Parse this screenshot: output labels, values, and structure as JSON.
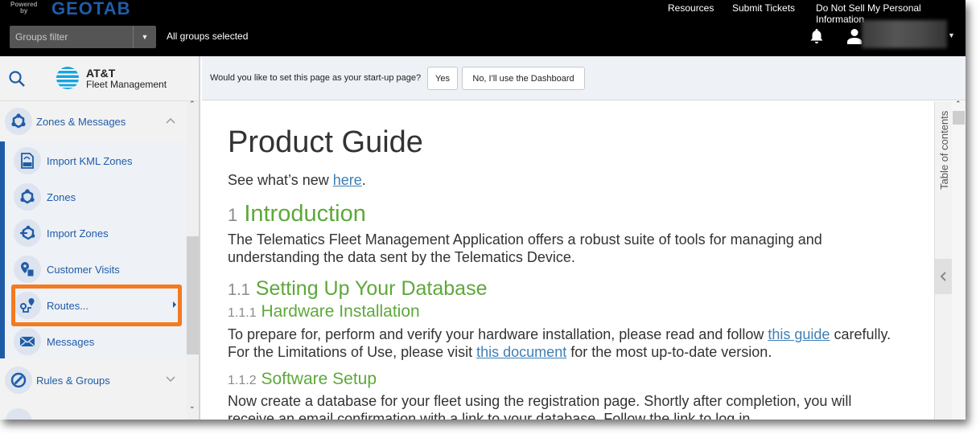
{
  "header": {
    "powered_by": "Powered by",
    "brand": "GEOTAB",
    "groups_filter_placeholder": "Groups filter",
    "groups_status": "All groups selected",
    "links": [
      "Resources",
      "Submit Tickets",
      "Do Not Sell My Personal Information"
    ],
    "icons": {
      "notifications": "bell-icon",
      "user": "user-icon",
      "user_menu": "caret-down-icon"
    }
  },
  "sidebar": {
    "logo_line1": "AT&T",
    "logo_line2": "Fleet Management",
    "groups": [
      {
        "label": "Zones & Messages",
        "expanded": true,
        "icon": "zones-icon"
      },
      {
        "label": "Rules & Groups",
        "expanded": false,
        "icon": "rules-icon"
      }
    ],
    "sub_items": [
      {
        "label": "Import KML Zones",
        "icon": "kml-file-icon"
      },
      {
        "label": "Zones",
        "icon": "zones-icon"
      },
      {
        "label": "Import Zones",
        "icon": "import-zones-icon"
      },
      {
        "label": "Customer Visits",
        "icon": "customer-visits-icon"
      },
      {
        "label": "Routes...",
        "icon": "routes-icon",
        "has_submenu": true,
        "highlighted": true
      },
      {
        "label": "Messages",
        "icon": "envelope-icon"
      }
    ]
  },
  "startup_prompt": {
    "question": "Would you like to set this page as your start-up page?",
    "yes_label": "Yes",
    "no_label": "No, I'll use the Dashboard"
  },
  "document": {
    "title": "Product Guide",
    "intro_prefix": "See what’s new ",
    "intro_link": "here",
    "intro_suffix": ".",
    "sections": {
      "s1_num": "1",
      "s1_title": "Introduction",
      "s1_line1": "The Telematics Fleet Management Application offers a robust suite of tools for managing and",
      "s1_line2": "understanding the data sent by the Telematics Device.",
      "s11_num": "1.1",
      "s11_title": "Setting Up Your Database",
      "s111_num": "1.1.1",
      "s111_title": "Hardware Installation",
      "s111_line1_prefix": "To prepare for, perform and verify your hardware installation, please read and follow ",
      "s111_line1_link": "this guide",
      "s111_line1_suffix": " carefully.",
      "s111_line2_prefix": "For the Limitations of Use, please visit ",
      "s111_line2_link": "this document",
      "s111_line2_suffix": " for the most up-to-date version.",
      "s112_num": "1.1.2",
      "s112_title": "Software Setup",
      "s112_line1": "Now create a database for your fleet using the registration page. Shortly after completion, you will",
      "s112_line2": "receive an email confirmation with a link to your database. Follow the link to log in."
    }
  },
  "toc": {
    "label": "Table of contents"
  },
  "colors": {
    "brand_blue": "#1f5ca8",
    "heading_green": "#5ea83a",
    "link_blue": "#3d7fb5",
    "highlight_orange": "#f47a1f"
  }
}
